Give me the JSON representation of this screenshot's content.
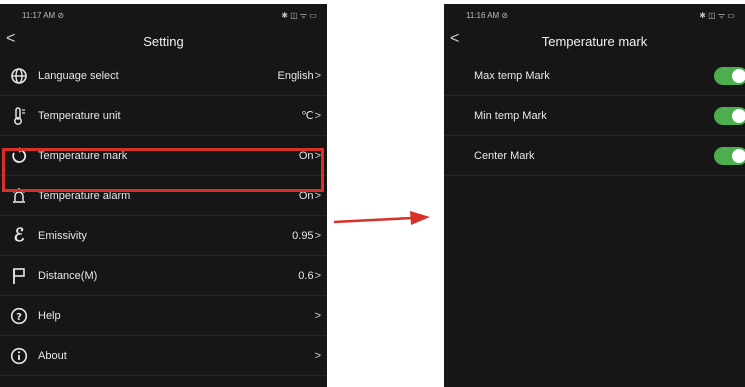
{
  "left": {
    "status": {
      "time": "11:17 AM ⊘",
      "icons": "✱ ◫ ᯤ ▭"
    },
    "nav": {
      "back": "<",
      "title": "Setting"
    },
    "items": [
      {
        "label": "Language select",
        "value": "English",
        "icon": "globe-icon"
      },
      {
        "label": "Temperature unit",
        "value": "℃",
        "icon": "thermometer-icon"
      },
      {
        "label": "Temperature mark",
        "value": "On",
        "icon": "cycle-icon"
      },
      {
        "label": "Temperature alarm",
        "value": "On",
        "icon": "alarm-lamp-icon"
      },
      {
        "label": "Emissivity",
        "value": "0.95",
        "icon": "epsilon-icon"
      },
      {
        "label": "Distance(M)",
        "value": "0.6",
        "icon": "flag-icon"
      },
      {
        "label": "Help",
        "value": "",
        "icon": "question-icon"
      },
      {
        "label": "About",
        "value": "",
        "icon": "info-icon"
      }
    ],
    "chevron": ">"
  },
  "right": {
    "status": {
      "time": "11:16 AM ⊘",
      "icons": "✱ ◫ ᯤ ▭"
    },
    "nav": {
      "back": "<",
      "title": "Temperature mark"
    },
    "toggles": [
      {
        "label": "Max temp Mark",
        "on": true
      },
      {
        "label": "Min temp Mark",
        "on": true
      },
      {
        "label": "Center Mark",
        "on": true
      }
    ]
  },
  "colors": {
    "highlight": "#d9302a",
    "arrow": "#d9302a",
    "toggle_on": "#4cae4c",
    "screen_bg": "#161616"
  }
}
